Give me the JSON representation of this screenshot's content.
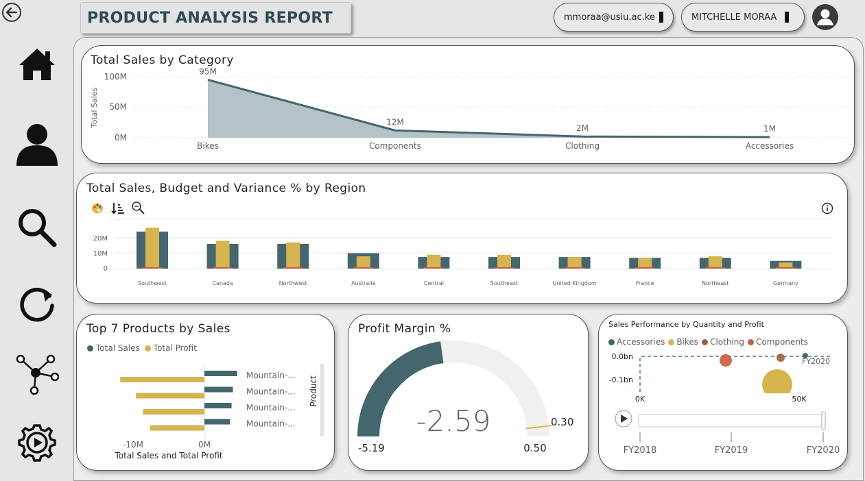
{
  "header": {
    "title": "PRODUCT ANALYSIS REPORT",
    "email": "mmoraa@usiu.ac.ke",
    "user_name": "MITCHELLE MORAA"
  },
  "sidebar": {
    "items": [
      {
        "name": "home",
        "icon": "home-icon"
      },
      {
        "name": "user",
        "icon": "user-icon"
      },
      {
        "name": "search",
        "icon": "search-icon"
      },
      {
        "name": "refresh",
        "icon": "refresh-icon"
      },
      {
        "name": "network",
        "icon": "network-icon"
      },
      {
        "name": "settings",
        "icon": "gear-play-icon"
      }
    ]
  },
  "colors": {
    "teal": "#44666e",
    "gold": "#d6b44f",
    "area": "#b3c3c7",
    "brown": "#a45d3c",
    "orange": "#cc5a3e",
    "light": "#f2f0ee"
  },
  "chart_data": [
    {
      "type": "area",
      "title": "Total Sales by Category",
      "ylabel": "Total Sales",
      "categories": [
        "Bikes",
        "Components",
        "Clothing",
        "Accessories"
      ],
      "values": [
        95,
        12,
        2,
        1
      ],
      "data_labels": [
        "95M",
        "12M",
        "2M",
        "1M"
      ],
      "y_ticks": [
        "0M",
        "50M",
        "100M"
      ],
      "ylim": [
        0,
        100
      ]
    },
    {
      "type": "bar",
      "title": "Total Sales, Budget and Variance % by Region",
      "categories": [
        "Southwest",
        "Canada",
        "Northwest",
        "Australia",
        "Central",
        "Southeast",
        "United Kingdom",
        "France",
        "Northeast",
        "Germany"
      ],
      "series": [
        {
          "values": [
            24,
            16,
            16,
            10,
            7.5,
            7.5,
            7.5,
            7,
            7,
            5
          ]
        },
        {
          "values": [
            26.5,
            18,
            17,
            8,
            9,
            9,
            7.5,
            7,
            8,
            4
          ]
        }
      ],
      "y_ticks": [
        "0",
        "10M",
        "20M"
      ],
      "ylim": [
        0,
        30
      ]
    },
    {
      "type": "bar",
      "title": "Top 7 Products by Sales",
      "orientation": "horizontal",
      "legend": [
        "Total Sales",
        "Total Profit"
      ],
      "categories": [
        "Mountain-...",
        "Mountain-...",
        "Mountain-...",
        "Mountain-..."
      ],
      "series": [
        {
          "name": "Total Sales",
          "values": [
            4.6,
            4.0,
            3.8,
            3.6
          ]
        },
        {
          "name": "Total Profit",
          "values": [
            -11.8,
            -9.6,
            -8.6,
            -7.6
          ]
        }
      ],
      "x_ticks": [
        "-10M",
        "0M"
      ],
      "xlabel": "Total Sales and Total Profit",
      "ylabel": "Product"
    },
    {
      "type": "gauge",
      "title": "Profit Margin %",
      "value": "-2.59",
      "min": "-5.19",
      "max": "0.50",
      "target": "0.30",
      "value_num": -2.59,
      "min_num": -5.19,
      "max_num": 0.5,
      "target_num": 0.3
    },
    {
      "type": "scatter",
      "title": "Sales Performance by Quantity and Profit",
      "legend": [
        "Accessories",
        "Bikes",
        "Clothing",
        "Components"
      ],
      "y_ticks": [
        "0.0bn",
        "-0.1bn"
      ],
      "x_ticks": [
        "0K",
        "50K"
      ],
      "frame_label": "FY2020",
      "play_axis": [
        "FY2018",
        "FY2019",
        "FY2020"
      ]
    }
  ]
}
